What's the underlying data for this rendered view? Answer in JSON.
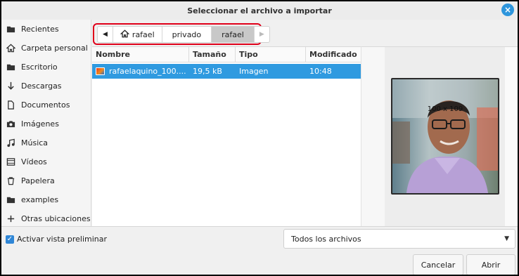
{
  "window": {
    "title": "Seleccionar el archivo a importar"
  },
  "sidebar": {
    "items": [
      {
        "label": "Recientes",
        "icon": "folder-icon"
      },
      {
        "label": "Carpeta personal",
        "icon": "home-icon"
      },
      {
        "label": "Escritorio",
        "icon": "folder-icon"
      },
      {
        "label": "Descargas",
        "icon": "download-icon"
      },
      {
        "label": "Documentos",
        "icon": "document-icon"
      },
      {
        "label": "Imágenes",
        "icon": "camera-icon"
      },
      {
        "label": "Música",
        "icon": "music-icon"
      },
      {
        "label": "Vídeos",
        "icon": "video-icon"
      },
      {
        "label": "Papelera",
        "icon": "trash-icon"
      },
      {
        "label": "examples",
        "icon": "folder-icon"
      },
      {
        "label": "Otras ubicaciones",
        "icon": "plus-icon"
      }
    ]
  },
  "pathbar": {
    "crumbs": [
      "rafael",
      "privado",
      "rafael"
    ],
    "active_index": 2
  },
  "filelist": {
    "columns": {
      "name": "Nombre",
      "size": "Tamaño",
      "type": "Tipo",
      "modified": "Modificado"
    },
    "rows": [
      {
        "name": "rafaelaquino_100....",
        "size": "19,5 kB",
        "type": "Imagen",
        "modified": "10:48",
        "selected": true
      }
    ]
  },
  "preview": {
    "dimensions": "100 x 109"
  },
  "bottom": {
    "preview_toggle_label": "Activar vista preliminar",
    "preview_toggle_checked": true,
    "filter_value": "Todos los archivos",
    "cancel_label": "Cancelar",
    "open_label": "Abrir"
  },
  "colors": {
    "accent": "#2f9ae0",
    "highlight_border": "#e0001a",
    "close_button": "#2d95dc"
  }
}
